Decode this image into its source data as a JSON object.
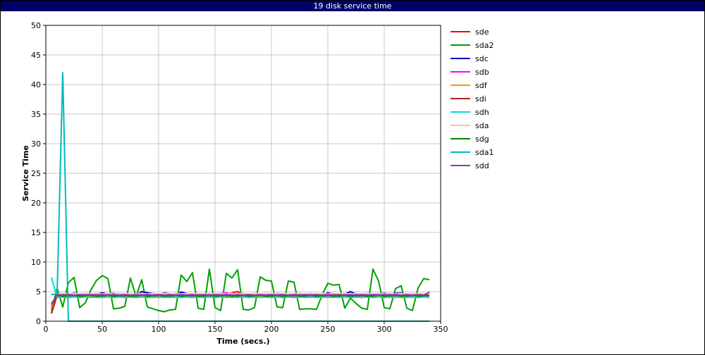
{
  "window": {
    "title": "19 disk service time"
  },
  "chart_data": {
    "type": "line",
    "title": "19 disk service time",
    "xlabel": "Time (secs.)",
    "ylabel": "Service Time",
    "xlim": [
      0,
      350
    ],
    "ylim": [
      0,
      50
    ],
    "xticks": [
      0,
      50,
      100,
      150,
      200,
      250,
      300,
      350
    ],
    "yticks": [
      0,
      5,
      10,
      15,
      20,
      25,
      30,
      35,
      40,
      45,
      50
    ],
    "grid": true,
    "legend_position": "right",
    "x": [
      5,
      10,
      15,
      20,
      25,
      30,
      35,
      40,
      45,
      50,
      55,
      60,
      65,
      70,
      75,
      80,
      85,
      90,
      95,
      100,
      105,
      110,
      115,
      120,
      125,
      130,
      135,
      140,
      145,
      150,
      155,
      160,
      165,
      170,
      175,
      180,
      185,
      190,
      195,
      200,
      205,
      210,
      215,
      220,
      225,
      230,
      235,
      240,
      245,
      250,
      255,
      260,
      265,
      270,
      275,
      280,
      285,
      290,
      295,
      300,
      305,
      310,
      315,
      320,
      325,
      330,
      335,
      340
    ],
    "series": [
      {
        "name": "sde",
        "color": "#ff0000",
        "values": [
          1.3,
          4.3,
          4.4,
          4.2,
          4.1,
          4.3,
          4.4,
          4.2,
          4.3,
          4.4,
          4.2,
          4.1,
          4.3,
          4.2,
          4.4,
          4.3,
          4.6,
          4.4,
          4.3,
          4.2,
          4.4,
          4.3,
          4.2,
          4.5,
          4.3,
          4.2,
          4.4,
          4.3,
          4.5,
          4.4,
          4.6,
          4.5,
          4.8,
          5.0,
          4.4,
          4.2,
          4.3,
          4.1,
          4.4,
          4.3,
          4.5,
          4.2,
          4.4,
          4.3,
          4.1,
          4.4,
          4.2,
          4.3,
          4.4,
          4.2,
          4.3,
          4.4,
          4.2,
          4.3,
          4.2,
          4.4,
          4.3,
          4.2,
          4.4,
          4.3,
          4.2,
          4.4,
          4.3,
          4.2,
          4.4,
          4.3,
          4.2,
          4.7
        ]
      },
      {
        "name": "sda2",
        "color": "#00a000",
        "values": [
          1.8,
          5.6,
          2.4,
          6.5,
          7.4,
          2.3,
          3.1,
          5.3,
          6.9,
          7.7,
          7.2,
          2.1,
          2.2,
          2.5,
          7.3,
          4.2,
          7.0,
          2.4,
          2.1,
          1.8,
          1.6,
          1.9,
          2.0,
          7.8,
          6.7,
          8.2,
          2.2,
          2.0,
          8.8,
          2.3,
          1.8,
          8.1,
          7.3,
          8.7,
          2.0,
          1.9,
          2.3,
          7.5,
          6.9,
          6.8,
          2.4,
          2.3,
          6.8,
          6.6,
          2.0,
          2.1,
          2.1,
          2.0,
          4.5,
          6.4,
          6.1,
          6.2,
          2.2,
          3.9,
          3.0,
          2.2,
          2.0,
          8.8,
          6.8,
          2.3,
          2.1,
          5.5,
          6.0,
          2.2,
          1.8,
          5.6,
          7.2,
          7.0
        ]
      },
      {
        "name": "sdc",
        "color": "#0000cc",
        "values": [
          2.3,
          4.3,
          4.7,
          4.3,
          4.8,
          4.4,
          4.5,
          4.3,
          4.6,
          4.8,
          4.6,
          4.7,
          4.4,
          4.5,
          4.4,
          4.4,
          5.0,
          4.8,
          4.7,
          4.4,
          4.8,
          4.6,
          4.4,
          4.9,
          4.7,
          4.5,
          4.7,
          4.4,
          4.3,
          4.4,
          4.6,
          4.2,
          4.5,
          4.4,
          4.3,
          4.1,
          4.3,
          4.5,
          4.4,
          4.2,
          4.7,
          4.6,
          4.3,
          4.4,
          4.5,
          4.2,
          4.5,
          4.3,
          4.4,
          4.8,
          4.6,
          4.5,
          4.6,
          5.0,
          4.6,
          4.4,
          4.7,
          4.5,
          4.6,
          4.7,
          4.6,
          4.7,
          4.8,
          4.4,
          4.2,
          4.5,
          4.2,
          4.3
        ]
      },
      {
        "name": "sdb",
        "color": "#ff00ff",
        "values": [
          2.5,
          4.1,
          4.3,
          4.1,
          4.2,
          4.3,
          4.1,
          4.2,
          4.3,
          4.2,
          4.1,
          4.3,
          4.2,
          4.1,
          4.3,
          4.2,
          4.4,
          4.3,
          4.1,
          4.2,
          4.3,
          4.1,
          4.2,
          4.3,
          4.2,
          4.1,
          4.3,
          4.2,
          4.4,
          4.6,
          4.7,
          4.8,
          4.5,
          4.3,
          4.2,
          4.1,
          4.3,
          4.2,
          4.1,
          4.3,
          4.2,
          4.1,
          4.3,
          4.2,
          4.1,
          4.2,
          4.3,
          4.1,
          4.2,
          4.3,
          4.1,
          4.2,
          4.3,
          4.2,
          4.1,
          4.3,
          4.2,
          4.1,
          4.3,
          4.2,
          4.1,
          4.3,
          4.2,
          4.1,
          4.3,
          4.2,
          4.1,
          4.3
        ]
      },
      {
        "name": "sdf",
        "color": "#ff9900",
        "values": [
          2.2,
          4.0,
          4.1,
          4.0,
          4.1,
          4.0,
          4.2,
          4.1,
          4.0,
          4.1,
          4.2,
          4.0,
          4.1,
          4.0,
          4.1,
          4.0,
          4.2,
          4.1,
          4.0,
          4.1,
          4.0,
          4.1,
          4.0,
          4.2,
          4.1,
          4.0,
          4.1,
          4.0,
          4.1,
          4.0,
          4.2,
          4.1,
          4.0,
          4.1,
          4.0,
          4.1,
          4.0,
          4.2,
          4.1,
          4.0,
          4.1,
          4.0,
          4.1,
          4.0,
          4.2,
          4.1,
          4.0,
          4.1,
          4.0,
          4.1,
          4.0,
          4.2,
          4.1,
          4.0,
          4.1,
          4.0,
          4.1,
          4.0,
          4.2,
          4.1,
          4.0,
          4.1,
          4.0,
          4.1,
          4.0,
          4.2,
          4.1,
          4.0
        ]
      },
      {
        "name": "sdi",
        "color": "#aa2222",
        "values": [
          1.4,
          4.5,
          4.4,
          4.3,
          4.4,
          4.2,
          4.3,
          4.4,
          4.3,
          4.2,
          4.4,
          4.3,
          4.2,
          4.4,
          4.3,
          4.2,
          4.4,
          4.3,
          4.2,
          4.4,
          4.3,
          4.2,
          4.4,
          4.3,
          4.2,
          4.4,
          4.3,
          4.2,
          4.4,
          4.3,
          4.2,
          4.4,
          4.3,
          4.2,
          4.4,
          4.3,
          4.2,
          4.4,
          4.3,
          4.2,
          4.4,
          4.3,
          4.2,
          4.4,
          4.3,
          4.2,
          4.4,
          4.3,
          4.2,
          4.4,
          4.3,
          4.2,
          4.4,
          4.3,
          4.2,
          4.4,
          4.3,
          4.2,
          4.4,
          4.3,
          4.2,
          4.4,
          4.3,
          4.2,
          4.4,
          4.3,
          4.2,
          4.8
        ]
      },
      {
        "name": "sdh",
        "color": "#00dddd",
        "values": [
          7.4,
          4.0,
          4.1,
          4.0,
          4.1,
          4.0,
          4.1,
          4.0,
          4.1,
          4.0,
          4.1,
          4.0,
          4.1,
          4.0,
          4.1,
          4.0,
          4.1,
          4.0,
          4.1,
          4.0,
          4.1,
          4.0,
          4.1,
          4.0,
          4.1,
          4.0,
          4.1,
          4.0,
          4.1,
          4.0,
          4.1,
          4.0,
          4.1,
          4.0,
          4.1,
          4.0,
          4.1,
          4.0,
          4.1,
          4.0,
          4.1,
          4.0,
          4.1,
          4.0,
          4.1,
          4.0,
          4.1,
          4.0,
          4.1,
          4.0,
          4.1,
          4.0,
          4.1,
          4.0,
          4.1,
          4.0,
          4.1,
          4.0,
          4.1,
          4.0,
          4.1,
          4.0,
          4.1,
          4.0,
          4.1,
          4.0,
          4.1,
          4.0
        ]
      },
      {
        "name": "sda",
        "color": "#ffbbbb",
        "values": [
          4.5,
          4.6,
          4.7,
          4.6,
          4.7,
          4.6,
          4.7,
          4.6,
          4.7,
          4.6,
          4.7,
          4.6,
          4.7,
          4.6,
          4.7,
          4.6,
          4.7,
          4.6,
          4.7,
          4.6,
          4.7,
          4.6,
          4.7,
          4.6,
          4.7,
          4.6,
          4.7,
          4.6,
          4.7,
          4.6,
          4.7,
          4.6,
          4.7,
          4.6,
          4.7,
          4.6,
          4.7,
          4.6,
          4.7,
          4.6,
          4.7,
          4.6,
          4.7,
          4.6,
          4.7,
          4.6,
          4.7,
          4.6,
          4.7,
          4.6,
          4.7,
          4.6,
          4.7,
          4.6,
          4.7,
          4.6,
          4.7,
          4.6,
          4.7,
          4.6,
          4.7,
          4.6,
          4.7,
          4.6,
          4.7,
          4.6,
          4.7,
          4.6
        ]
      },
      {
        "name": "sdg",
        "color": "#008800",
        "values": [
          3.0,
          4.4,
          4.2,
          4.3,
          4.4,
          4.2,
          4.3,
          4.4,
          4.2,
          4.3,
          4.4,
          4.2,
          4.3,
          4.4,
          4.2,
          4.3,
          4.4,
          4.2,
          4.3,
          4.4,
          4.2,
          4.3,
          4.4,
          4.2,
          4.3,
          4.4,
          4.2,
          4.3,
          4.4,
          4.2,
          4.3,
          4.4,
          4.2,
          4.3,
          4.4,
          4.2,
          4.3,
          4.4,
          4.2,
          4.3,
          4.4,
          4.2,
          4.3,
          4.4,
          4.2,
          4.3,
          4.4,
          4.2,
          4.3,
          4.4,
          4.2,
          4.3,
          4.4,
          4.2,
          4.3,
          4.4,
          4.2,
          4.3,
          4.4,
          4.2,
          4.3,
          4.4,
          4.2,
          4.3,
          4.4,
          4.2,
          4.3,
          4.4
        ]
      },
      {
        "name": "sda1",
        "color": "#00bbbb",
        "values": [
          4.5,
          4.6,
          42.0,
          0,
          0,
          0,
          0,
          0,
          0,
          0,
          0,
          0,
          0,
          0,
          0,
          0,
          0,
          0,
          0,
          0,
          0,
          0,
          0,
          0,
          0,
          0,
          0,
          0,
          0,
          0,
          0,
          0,
          0,
          0,
          0,
          0,
          0,
          0,
          0,
          0,
          0,
          0,
          0,
          0,
          0,
          0,
          0,
          0,
          0,
          0,
          0,
          0,
          0,
          0,
          0,
          0,
          0,
          0,
          0,
          0,
          0,
          0,
          0,
          0,
          0,
          0,
          0,
          0
        ]
      },
      {
        "name": "sdd",
        "color": "#9933aa",
        "values": [
          2.8,
          4.5,
          4.4,
          4.5,
          4.4,
          4.5,
          4.4,
          4.5,
          4.4,
          4.5,
          4.4,
          4.5,
          4.4,
          4.5,
          4.4,
          4.5,
          4.4,
          4.5,
          4.4,
          4.5,
          4.4,
          4.5,
          4.4,
          4.5,
          4.4,
          4.5,
          4.4,
          4.5,
          4.4,
          4.5,
          4.4,
          4.5,
          4.4,
          4.5,
          4.4,
          4.5,
          4.4,
          4.5,
          4.4,
          4.5,
          4.4,
          4.5,
          4.4,
          4.5,
          4.4,
          4.5,
          4.4,
          4.5,
          4.4,
          4.5,
          4.4,
          4.5,
          4.4,
          4.5,
          4.4,
          4.5,
          4.4,
          4.5,
          4.4,
          4.5,
          4.4,
          4.5,
          4.4,
          4.5,
          4.4,
          4.5,
          4.4,
          4.9
        ]
      }
    ]
  }
}
